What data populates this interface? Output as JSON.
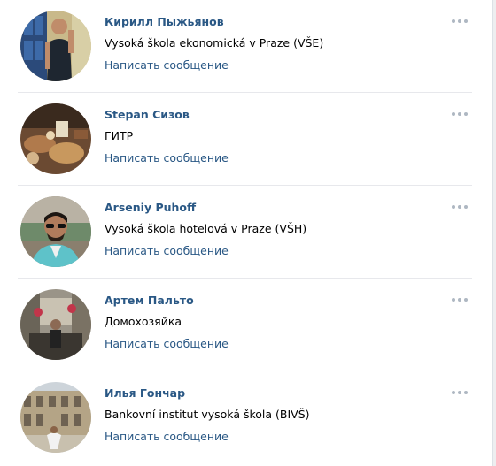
{
  "friends": [
    {
      "name": "Кирилл Пыжьянов",
      "subtitle": "Vysoká škola ekonomická v Praze (VŠE)",
      "message_label": "Написать сообщение",
      "more_icon": "ellipsis-icon"
    },
    {
      "name": "Stepan Сизов",
      "subtitle": "ГИТР",
      "message_label": "Написать сообщение",
      "more_icon": "ellipsis-icon"
    },
    {
      "name": "Arseniy Puhoff",
      "subtitle": "Vysoká škola hotelová v Praze (VŠH)",
      "message_label": "Написать сообщение",
      "more_icon": "ellipsis-icon"
    },
    {
      "name": "Артем Пальто",
      "subtitle": "Домохозяйка",
      "message_label": "Написать сообщение",
      "more_icon": "ellipsis-icon"
    },
    {
      "name": "Илья Гончар",
      "subtitle": "Bankovní institut vysoká škola (BIVŠ)",
      "message_label": "Написать сообщение",
      "more_icon": "ellipsis-icon"
    }
  ],
  "colors": {
    "link": "#2a5885",
    "text": "#000000",
    "divider": "#e7e8ec",
    "more_dots": "#aeb7c2"
  }
}
